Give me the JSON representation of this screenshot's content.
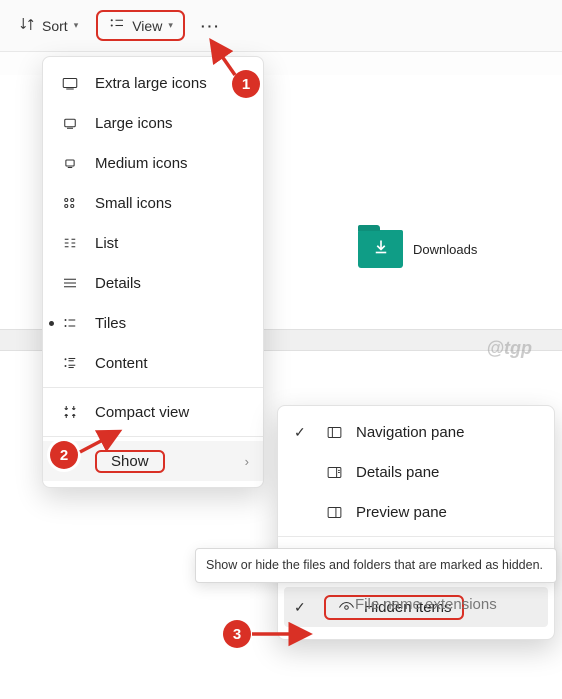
{
  "toolbar": {
    "sort_label": "Sort",
    "view_label": "View"
  },
  "folder": {
    "name": "Downloads"
  },
  "watermark": "@tgp",
  "view_menu": {
    "items": [
      "Extra large icons",
      "Large icons",
      "Medium icons",
      "Small icons",
      "List",
      "Details",
      "Tiles",
      "Content"
    ],
    "compact": "Compact view",
    "show": "Show"
  },
  "show_menu": {
    "items": [
      "Navigation pane",
      "Details pane",
      "Preview pane",
      "File name extensions",
      "Hidden items"
    ]
  },
  "tooltip": "Show or hide the files and folders that are marked as hidden.",
  "badges": {
    "one": "1",
    "two": "2",
    "three": "3"
  }
}
